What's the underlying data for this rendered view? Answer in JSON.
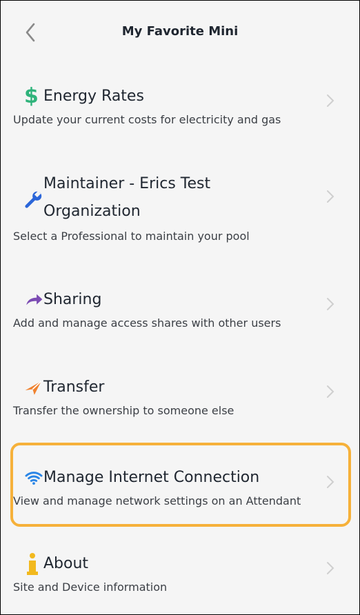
{
  "header": {
    "title": "My Favorite Mini",
    "back_icon": "chevron-left-icon"
  },
  "items": [
    {
      "label": "Energy Rates",
      "subtitle": "Update your current costs for electricity and gas",
      "icon": "dollar-icon",
      "color": "#2fb37b"
    },
    {
      "label": "Maintainer - Erics Test",
      "label2": "Organization",
      "subtitle": "Select a Professional to maintain your pool",
      "icon": "wrench-icon",
      "color": "#2b66d9"
    },
    {
      "label": "Sharing",
      "subtitle": "Add and manage access shares with other users",
      "icon": "share-arrow-icon",
      "color": "#7b4bb3"
    },
    {
      "label": "Transfer",
      "subtitle": "Transfer the ownership to someone else",
      "icon": "paper-plane-icon",
      "color": "#f0822f"
    },
    {
      "label": "Manage Internet Connection",
      "subtitle": "View and manage network settings on an Attendant",
      "icon": "wifi-icon",
      "color": "#2b86e6"
    },
    {
      "label": "About",
      "subtitle": "Site and Device information",
      "icon": "info-icon",
      "color": "#f2b91e"
    }
  ],
  "highlight_color": "#f6b13a"
}
